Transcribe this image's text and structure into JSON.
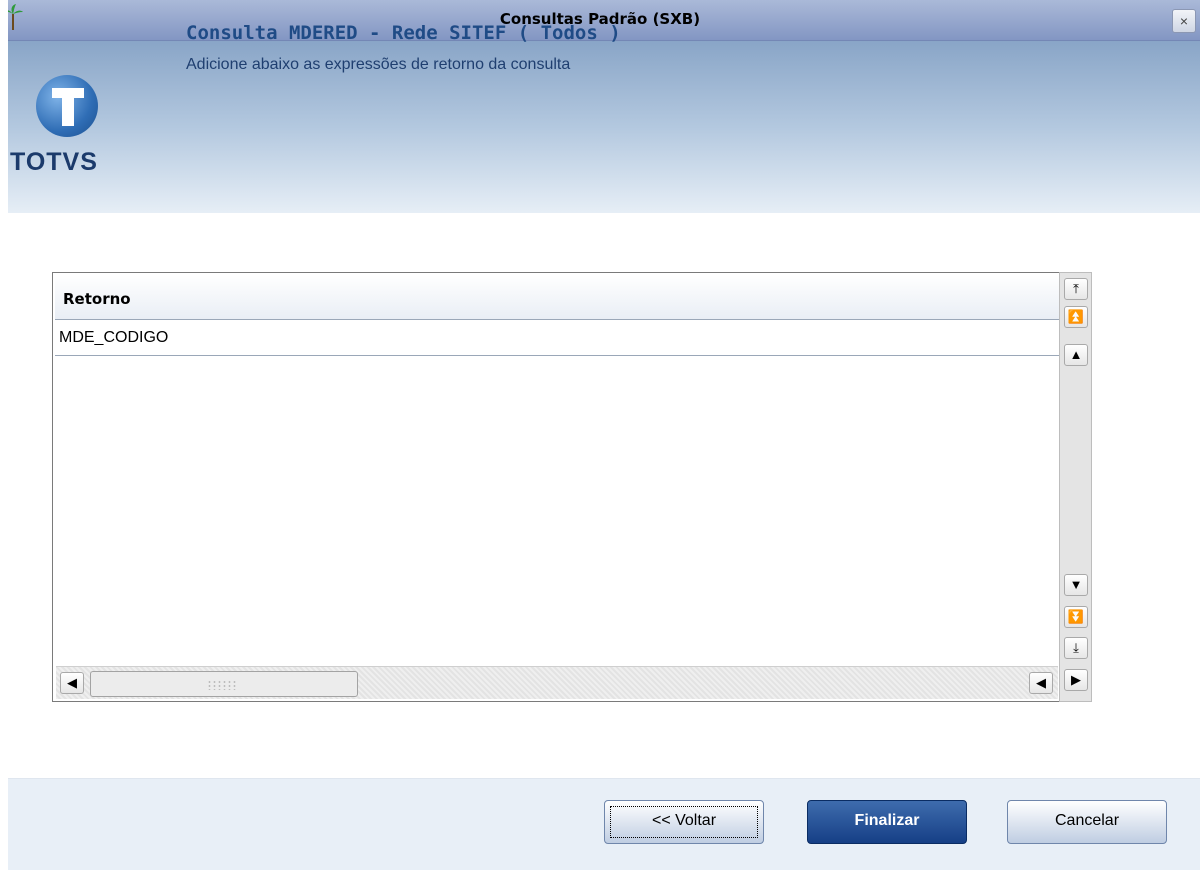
{
  "window": {
    "title": "Consultas Padrão (SXB)",
    "close_symbol": "×"
  },
  "header": {
    "logo_text": "TOTVS",
    "title": "Consulta MDERED - Rede SITEF ( Todos )",
    "subtitle": "Adicione abaixo as expressões de retorno da consulta"
  },
  "grid": {
    "columns": [
      "Retorno"
    ],
    "rows": [
      [
        "MDE_CODIGO"
      ]
    ]
  },
  "buttons": {
    "back": "<< Voltar",
    "finish": "Finalizar",
    "cancel": "Cancelar"
  },
  "scroll_icons": {
    "first": "⤒",
    "page_up": "⏫",
    "up": "▲",
    "down": "▼",
    "page_down": "⏬",
    "last": "⤓",
    "left": "◀",
    "right": "▶"
  },
  "colors": {
    "finish_button": "#1f4b8f",
    "header_title": "#1f4b86",
    "logo": "#2f6db5"
  }
}
